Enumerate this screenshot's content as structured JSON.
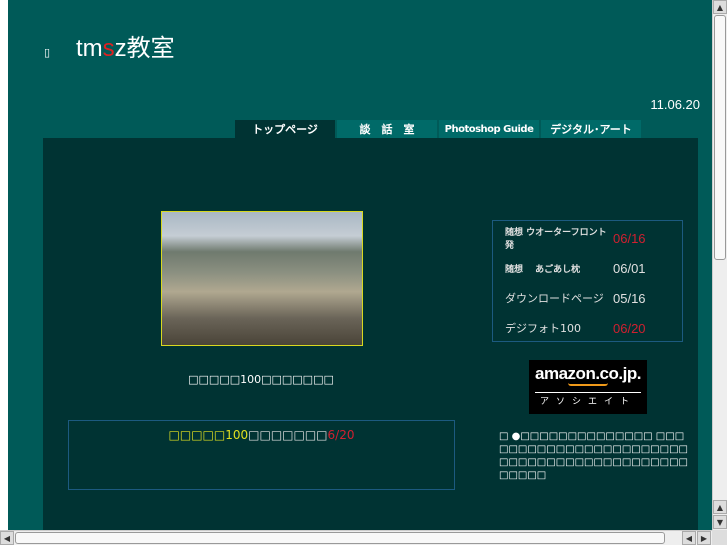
{
  "header": {
    "logo_prefix": "tm",
    "logo_s": "s",
    "logo_suffix": "z教室",
    "tofu": "▯",
    "date": "11.06.20"
  },
  "tabs": [
    {
      "label": "トップページ"
    },
    {
      "label": "談　話　室"
    },
    {
      "label": "Photoshop Guide"
    },
    {
      "label": "デジタル･アート"
    }
  ],
  "main": {
    "caption": "□□□□□100□□□□□□□",
    "box": {
      "part1": "□□□□□",
      "part2": "100",
      "part3": "□□□□□□□",
      "date": "6/20"
    },
    "news": [
      {
        "label": "随想 ウオーターフロント発",
        "date": "06/16",
        "hot": true
      },
      {
        "label": "随想　 あごあし枕",
        "date": "06/01",
        "hot": false
      },
      {
        "label": "ダウンロードページ",
        "date": "05/16",
        "hot": false
      },
      {
        "label": "デジフォト100",
        "date": "06/20",
        "hot": true
      }
    ],
    "amazon": {
      "logo": "amazon.co.jp.",
      "sub": "アソシエイト"
    },
    "note": "□ ●□□□□□□□□□□□□□□ □□□□□□□□□□□□□□□□□□□□□□□□□□□□□□□□□□□□□□□□□□□□□□□□"
  },
  "colors": {
    "page": "#005a58",
    "panel": "#003333",
    "accent": "#d02030"
  }
}
